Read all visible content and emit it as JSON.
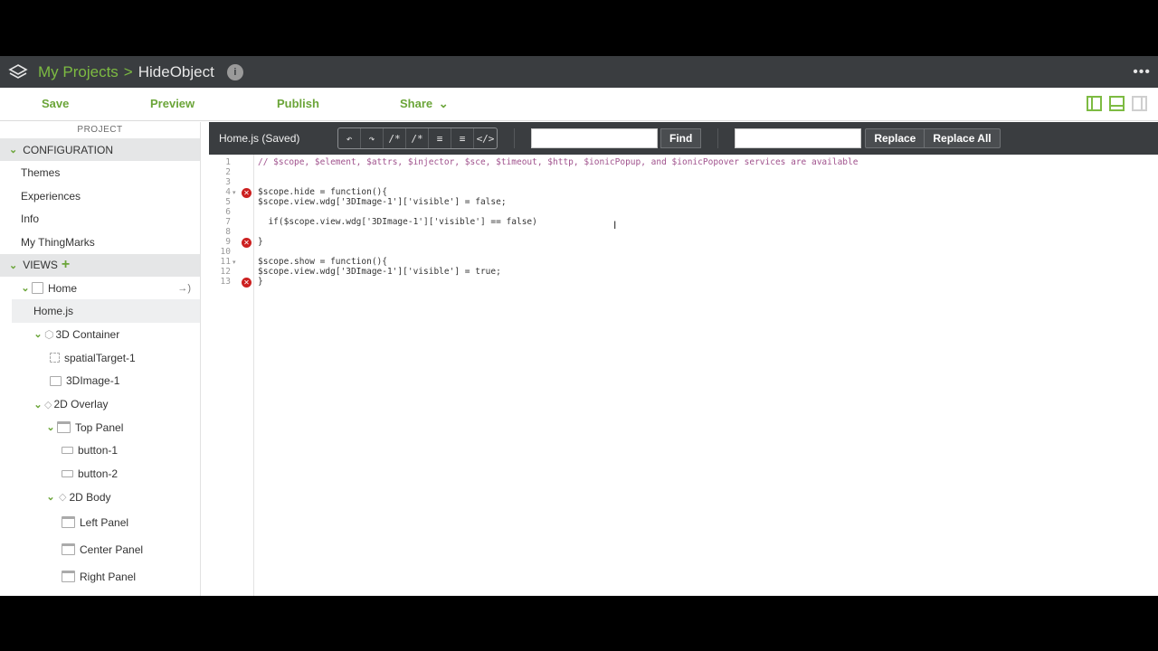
{
  "header": {
    "breadcrumb_root": "My Projects",
    "breadcrumb_sep": ">",
    "project_name": "HideObject",
    "info_icon_label": "i",
    "more_label": "•••"
  },
  "actions": {
    "save": "Save",
    "preview": "Preview",
    "publish": "Publish",
    "share": "Share"
  },
  "sidebar": {
    "title": "PROJECT",
    "configuration": "CONFIGURATION",
    "config_items": [
      "Themes",
      "Experiences",
      "Info",
      "My ThingMarks"
    ],
    "views": "VIEWS",
    "tree": {
      "home": "Home",
      "home_js": "Home.js",
      "container3d": "3D Container",
      "spatial_target": "spatialTarget-1",
      "image3d": "3DImage-1",
      "overlay2d": "2D Overlay",
      "top_panel": "Top Panel",
      "button1": "button-1",
      "button2": "button-2",
      "body2d": "2D Body",
      "left_panel": "Left Panel",
      "center_panel": "Center Panel",
      "right_panel": "Right Panel"
    }
  },
  "editor": {
    "file_title": "Home.js (Saved)",
    "find_label": "Find",
    "replace_label": "Replace",
    "replace_all_label": "Replace All",
    "find_value": "",
    "replace_value": "",
    "lines": [
      {
        "n": "1",
        "text": "// $scope, $element, $attrs, $injector, $sce, $timeout, $http, $ionicPopup, and $ionicPopover services are available"
      },
      {
        "n": "2",
        "text": ""
      },
      {
        "n": "3",
        "text": ""
      },
      {
        "n": "4",
        "text": "$scope.hide = function(){"
      },
      {
        "n": "5",
        "text": "$scope.view.wdg['3DImage-1']['visible'] = false;"
      },
      {
        "n": "6",
        "text": ""
      },
      {
        "n": "7",
        "text": "  if($scope.view.wdg['3DImage-1']['visible'] == false)"
      },
      {
        "n": "8",
        "text": ""
      },
      {
        "n": "9",
        "text": "}"
      },
      {
        "n": "10",
        "text": ""
      },
      {
        "n": "11",
        "text": "$scope.show = function(){"
      },
      {
        "n": "12",
        "text": "$scope.view.wdg['3DImage-1']['visible'] = true;"
      },
      {
        "n": "13",
        "text": "}"
      }
    ]
  },
  "colors": {
    "accent": "#6ba539",
    "header_bg": "#3a3d40",
    "error": "#cc2020"
  }
}
